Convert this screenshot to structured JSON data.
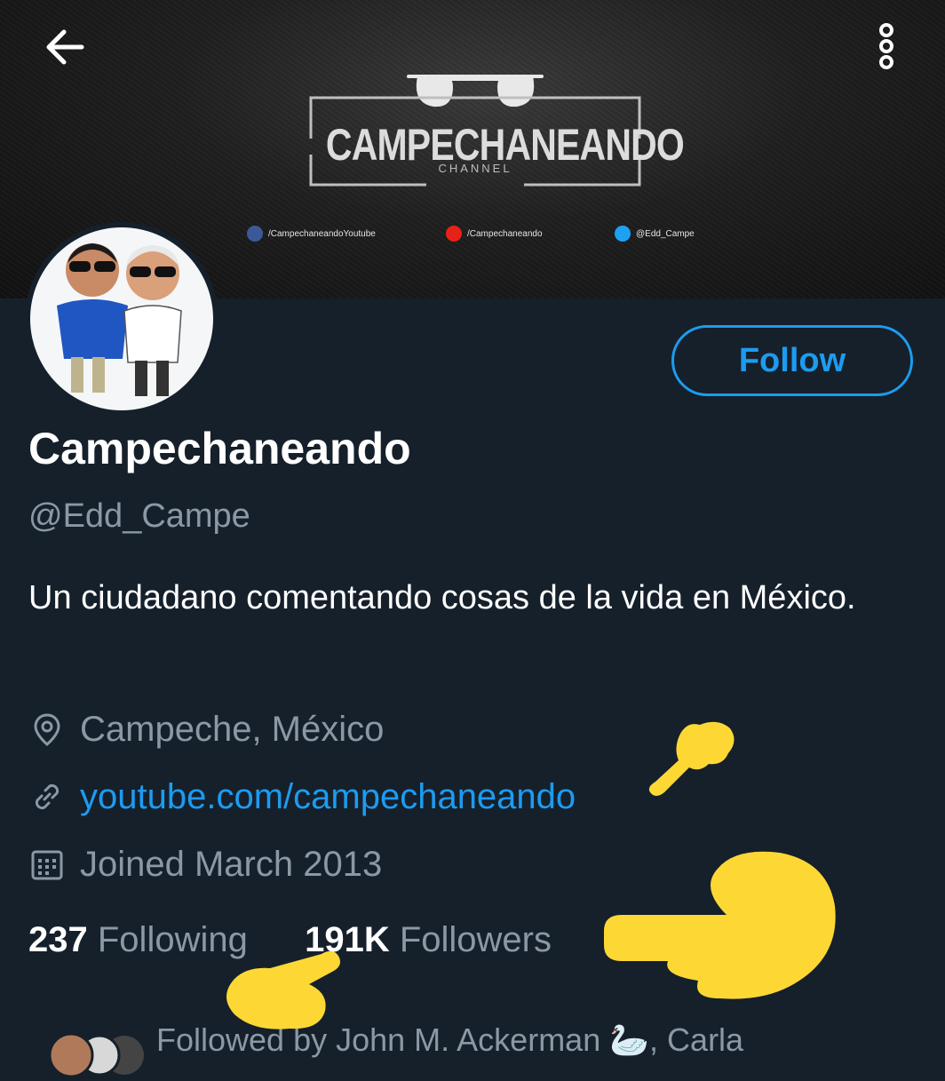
{
  "header": {
    "back_icon": "arrow-left-icon",
    "more_icon": "more-vertical-icon"
  },
  "banner": {
    "logo_title": "CAMPECHANEANDO",
    "logo_subtitle": "CHANNEL",
    "social_links": [
      {
        "icon": "facebook-icon",
        "label": "/CampechaneandoYoutube",
        "color": "#3b5998"
      },
      {
        "icon": "youtube-icon",
        "label": "/Campechaneando",
        "color": "#e62117"
      },
      {
        "icon": "twitter-icon",
        "label": "@Edd_Campe",
        "color": "#1da1f2"
      }
    ]
  },
  "profile": {
    "follow_label": "Follow",
    "name": "Campechaneando",
    "handle": "@Edd_Campe",
    "bio": "Un ciudadano comentando cosas de la vida en México.",
    "location": "Campeche, México",
    "website": "youtube.com/campechaneando",
    "joined": "Joined March 2013",
    "following_count": "237",
    "following_label": "Following",
    "followers_count": "191K",
    "followers_label": "Followers",
    "followed_by": "Followed by John M. Ackerman 🦢, Carla"
  },
  "colors": {
    "background": "#15202b",
    "accent": "#1d9bf0",
    "muted": "#8b98a5",
    "annotation": "#fdd835"
  }
}
